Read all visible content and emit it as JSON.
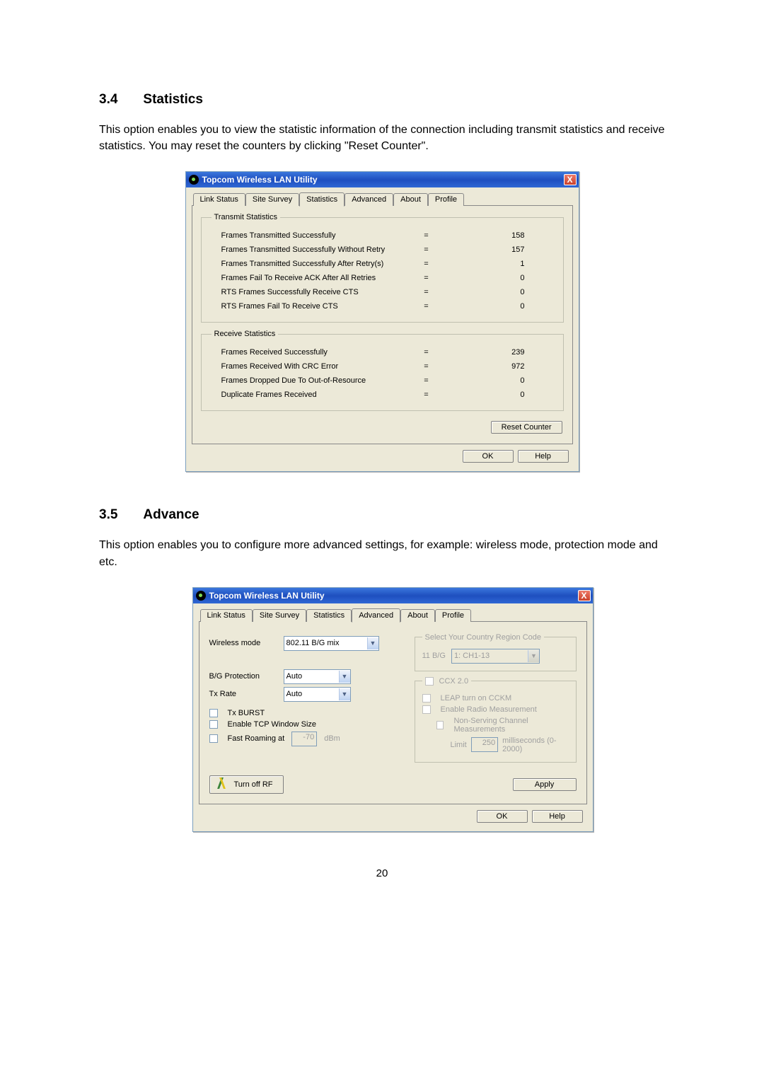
{
  "sections": {
    "s34_num": "3.4",
    "s34_title": "Statistics",
    "s34_body": "This option enables you to view the statistic information of the connection including transmit statistics and receive statistics. You may reset the counters by clicking \"Reset Counter\".",
    "s35_num": "3.5",
    "s35_title": "Advance",
    "s35_body": "This option enables you to configure more advanced settings, for example: wireless mode, protection mode and etc."
  },
  "window": {
    "title": "Topcom Wireless LAN Utility",
    "close": "X"
  },
  "tabs": {
    "link_status": "Link Status",
    "site_survey": "Site Survey",
    "statistics": "Statistics",
    "advanced": "Advanced",
    "about": "About",
    "profile": "Profile"
  },
  "stats": {
    "tx_legend": "Transmit Statistics",
    "rx_legend": "Receive Statistics",
    "rows_tx": [
      {
        "label": "Frames Transmitted Successfully",
        "value": "158"
      },
      {
        "label": "Frames Transmitted Successfully  Without Retry",
        "value": "157"
      },
      {
        "label": "Frames Transmitted Successfully After Retry(s)",
        "value": "1"
      },
      {
        "label": "Frames Fail To Receive ACK After All Retries",
        "value": "0"
      },
      {
        "label": "RTS Frames Successfully Receive CTS",
        "value": "0"
      },
      {
        "label": "RTS Frames Fail To Receive CTS",
        "value": "0"
      }
    ],
    "rows_rx": [
      {
        "label": "Frames Received Successfully",
        "value": "239"
      },
      {
        "label": "Frames Received With CRC Error",
        "value": "972"
      },
      {
        "label": "Frames Dropped Due To Out-of-Resource",
        "value": "0"
      },
      {
        "label": "Duplicate Frames Received",
        "value": "0"
      }
    ],
    "reset": "Reset Counter"
  },
  "buttons": {
    "ok": "OK",
    "help": "Help",
    "apply": "Apply"
  },
  "adv": {
    "wireless_mode_label": "Wireless mode",
    "wireless_mode_value": "802.11 B/G mix",
    "country_legend": "Select Your Country Region Code",
    "country_band": "11 B/G",
    "country_value": "1: CH1-13",
    "bg_protection_label": "B/G Protection",
    "bg_protection_value": "Auto",
    "txrate_label": "Tx Rate",
    "txrate_value": "Auto",
    "txburst_label": "Tx BURST",
    "enable_tcp_label": "Enable TCP Window Size",
    "fast_roaming_label": "Fast Roaming at",
    "fast_roaming_value": "-70",
    "fast_roaming_unit": "dBm",
    "ccx_legend": "CCX 2.0",
    "leap_label": "LEAP turn on CCKM",
    "radio_label": "Enable Radio Measurement",
    "nonserving_label": "Non-Serving Channel Measurements",
    "limit_label": "Limit",
    "limit_value": "250",
    "limit_unit": "milliseconds (0-2000)",
    "turn_off_rf": "Turn off RF"
  },
  "page_number": "20"
}
